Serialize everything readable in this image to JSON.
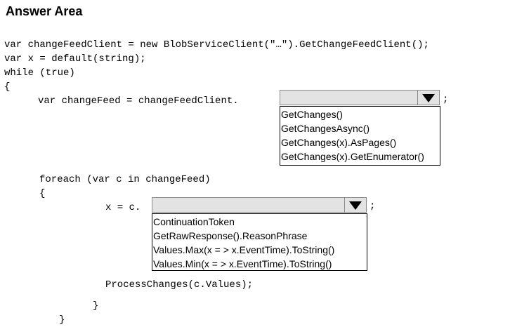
{
  "header": {
    "title": "Answer Area"
  },
  "code": {
    "line1": "var changeFeedClient = new BlobServiceClient(\"…\").GetChangeFeedClient();",
    "line2": "var x = default(string);",
    "line3": "while (true)",
    "line4": "{",
    "line5": "var changeFeed = changeFeedClient.",
    "line5_end": ";",
    "line6": "foreach (var c in changeFeed)",
    "line7": "{",
    "line8": "x = c.",
    "line8_end": ";",
    "line9": "ProcessChanges(c.Values);",
    "line10": "}",
    "line11": "}"
  },
  "dropdown1": {
    "selected": "",
    "options": [
      "GetChanges()",
      "GetChangesAsync()",
      "GetChanges(x).AsPages()",
      "GetChanges(x).GetEnumerator()"
    ]
  },
  "dropdown2": {
    "selected": "",
    "options": [
      "ContinuationToken",
      "GetRawResponse().ReasonPhrase",
      "Values.Max(x = > x.EventTime).ToString()",
      "Values.Min(x = > x.EventTime).ToString()"
    ]
  }
}
